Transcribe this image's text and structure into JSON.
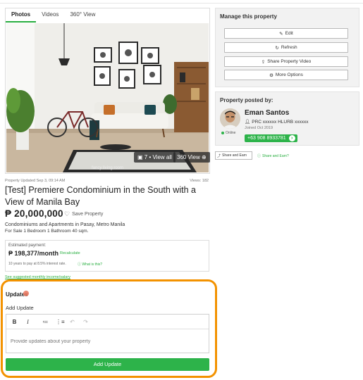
{
  "tabs": [
    "Photos",
    "Videos",
    "360° View"
  ],
  "photo": {
    "caption": "fancy living room",
    "view_all": "7 • View all",
    "view_360": "360 View"
  },
  "listing": {
    "updated": "Property Updated Sep 3, 09:14 AM",
    "views": "Views: 182",
    "title": "[Test] Premiere Condominium in the South with a View of Manila Bay",
    "price": "₱ 20,000,000",
    "save_label": "Save Property",
    "type": "Condominiums and Apartments in Pasay, Metro Manila",
    "facts": "For Sale  1 Bedroom  1 Bathroom  40 sqm."
  },
  "mortgage": {
    "label": "Estimated payment:",
    "value": "₱ 198,377/month",
    "recalculate": "Recalculate",
    "note": "10 years to pay at 8.5% interest rate.",
    "what_is_this": "What is this?",
    "salary_link": "See suggested monthly income/salary"
  },
  "updates": {
    "heading": "Updates",
    "add_label": "Add Update",
    "toolbar": [
      "B",
      "I",
      "≔",
      "⋮≡",
      "↶",
      "↷"
    ],
    "placeholder": "Provide updates about your property",
    "submit": "Add Update"
  },
  "manage": {
    "title": "Manage this property",
    "buttons": [
      "Edit",
      "Refresh",
      "Share Property Video",
      "More Options"
    ]
  },
  "agent": {
    "section_title": "Property posted by:",
    "name": "Eman Santos",
    "license": "PRC xxxxxx HLURB xxxxxx",
    "joined": "Joined Oct 2019",
    "online": "Online",
    "phone": "+63 908 8933781"
  },
  "share": {
    "button": "Share and Earn",
    "link": "Share and Earn?"
  },
  "colors": {
    "accent_green": "#2db34a",
    "highlight_orange": "#f39200"
  }
}
